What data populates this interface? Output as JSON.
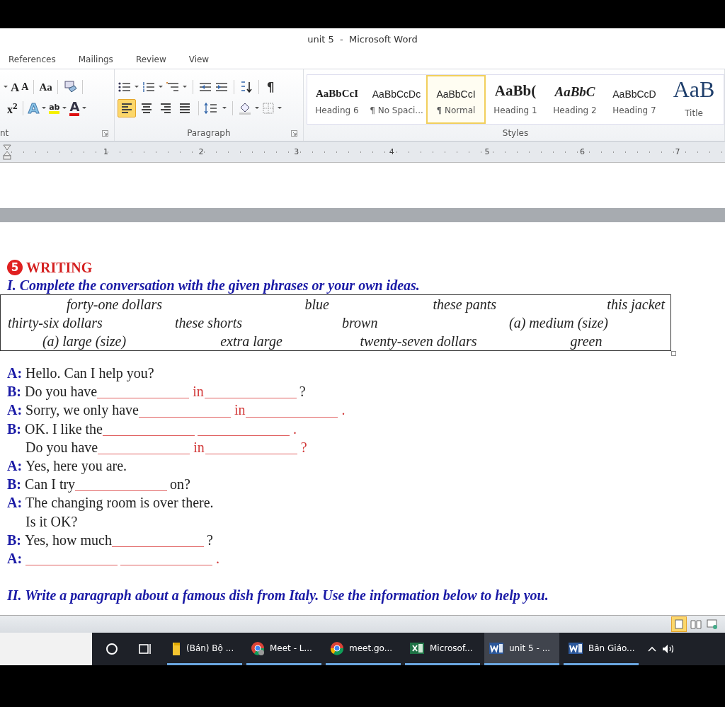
{
  "window": {
    "title": "unit 5  -  Microsoft Word"
  },
  "tabs": [
    {
      "label": "References",
      "selected": false
    },
    {
      "label": "Mailings",
      "selected": false
    },
    {
      "label": "Review",
      "selected": false
    },
    {
      "label": "View",
      "selected": false
    }
  ],
  "ribbon": {
    "font_group": {
      "label": "nt",
      "row1": [
        {
          "kind": "dropdown"
        },
        {
          "kind": "grow",
          "label": "A"
        },
        {
          "kind": "shrink",
          "label": "A"
        },
        {
          "kind": "case",
          "label": "Aa"
        },
        {
          "kind": "clear"
        }
      ],
      "row2": [
        {
          "kind": "superscript",
          "label": "x$^{2}$"
        },
        {
          "kind": "effects",
          "label": "A"
        },
        {
          "kind": "highlight",
          "label": "ab"
        },
        {
          "kind": "color",
          "label": "A"
        }
      ]
    },
    "paragraph_group": {
      "label": "Paragraph",
      "row1": [
        {
          "kind": "bullets"
        },
        {
          "kind": "numbering"
        },
        {
          "kind": "multilevel"
        },
        {
          "kind": "outdent"
        },
        {
          "kind": "indent"
        },
        {
          "kind": "sort"
        },
        {
          "kind": "pilcrow",
          "label": "¶"
        }
      ],
      "align": [
        {
          "selected": true
        },
        {
          "selected": false
        },
        {
          "selected": false
        },
        {
          "selected": false
        }
      ],
      "row2": [
        {
          "kind": "spacing"
        },
        {
          "kind": "shading"
        },
        {
          "kind": "borders"
        }
      ]
    },
    "styles_group": {
      "label": "Styles",
      "items": [
        {
          "sample": "AaBbCcI",
          "label": "Heading 6",
          "kind": "bold",
          "selected": false
        },
        {
          "sample": "AaBbCcDc",
          "label": "¶ No Spaci...",
          "kind": "plain",
          "selected": false
        },
        {
          "sample": "AaBbCcI",
          "label": "¶ Normal",
          "kind": "plain",
          "selected": true
        },
        {
          "sample": "AaBb(",
          "label": "Heading 1",
          "kind": "heavy",
          "selected": false
        },
        {
          "sample": "AaBbC",
          "label": "Heading 2",
          "kind": "italic",
          "selected": false
        },
        {
          "sample": "AaBbCcD",
          "label": "Heading 7",
          "kind": "plain",
          "selected": false
        },
        {
          "sample": "AaB",
          "label": "Title",
          "kind": "title",
          "selected": false
        }
      ]
    }
  },
  "ruler": {
    "numbers": [
      "1",
      "2",
      "3",
      "4",
      "5",
      "6",
      "7"
    ]
  },
  "document": {
    "section_number": "5",
    "section_title": "WRITING",
    "instruction_1": "I. Complete the conversation with the given phrases or your own ideas.",
    "word_box": [
      [
        "forty-one dollars",
        "blue",
        "these pants",
        "this jacket"
      ],
      [
        "thirty-six dollars",
        "these shorts",
        "brown",
        "(a) medium (size)"
      ],
      [
        "(a) large (size)",
        "extra large",
        "twenty-seven dollars",
        "green"
      ]
    ],
    "dialogue": [
      {
        "speaker": "A:",
        "parts": [
          {
            "kind": "text",
            "text": "Hello. Can I help you?"
          }
        ]
      },
      {
        "speaker": "B:",
        "parts": [
          {
            "kind": "text",
            "text": "Do you have"
          },
          {
            "kind": "blank"
          },
          {
            "kind": "red",
            "text": "in"
          },
          {
            "kind": "blank"
          },
          {
            "kind": "text",
            "text": "?"
          }
        ]
      },
      {
        "speaker": "A:",
        "parts": [
          {
            "kind": "text",
            "text": "Sorry, we only have"
          },
          {
            "kind": "blank"
          },
          {
            "kind": "red",
            "text": "in"
          },
          {
            "kind": "blank"
          },
          {
            "kind": "red",
            "text": "."
          }
        ]
      },
      {
        "speaker": "B:",
        "parts": [
          {
            "kind": "text",
            "text": "OK. I like the"
          },
          {
            "kind": "blank"
          },
          {
            "kind": "blank"
          },
          {
            "kind": "red",
            "text": "."
          }
        ]
      },
      {
        "parts": [
          {
            "kind": "text",
            "text": "Do you have"
          },
          {
            "kind": "blank"
          },
          {
            "kind": "red",
            "text": "in"
          },
          {
            "kind": "blank"
          },
          {
            "kind": "red",
            "text": "?"
          }
        ]
      },
      {
        "speaker": "A:",
        "parts": [
          {
            "kind": "text",
            "text": "Yes, here you are."
          }
        ]
      },
      {
        "speaker": "B:",
        "parts": [
          {
            "kind": "text",
            "text": "Can I try"
          },
          {
            "kind": "blank"
          },
          {
            "kind": "text",
            "text": "on?"
          }
        ]
      },
      {
        "speaker": "A:",
        "parts": [
          {
            "kind": "text",
            "text": "The changing room is over there."
          }
        ]
      },
      {
        "parts": [
          {
            "kind": "text",
            "text": "Is it OK?"
          }
        ]
      },
      {
        "speaker": "B:",
        "parts": [
          {
            "kind": "text",
            "text": "Yes, how much"
          },
          {
            "kind": "blank"
          },
          {
            "kind": "text",
            "text": "?"
          }
        ]
      },
      {
        "speaker": "A:",
        "parts": [
          {
            "kind": "blank"
          },
          {
            "kind": "blank"
          },
          {
            "kind": "red",
            "text": "."
          }
        ]
      }
    ],
    "instruction_2": "II. Write a paragraph about a famous dish from Italy. Use the information below to help you."
  },
  "status_bar": {
    "views": [
      {
        "selected": true
      },
      {
        "selected": false
      },
      {
        "selected": false
      }
    ]
  },
  "taskbar": {
    "apps": [
      {
        "kind": "folder",
        "label": "(Bán) Bộ ...",
        "selected": false
      },
      {
        "kind": "meet",
        "label": "Meet - L...",
        "selected": false
      },
      {
        "kind": "chrome",
        "label": "meet.go...",
        "selected": false
      },
      {
        "kind": "excel",
        "label": "Microsof...",
        "selected": false
      },
      {
        "kind": "word",
        "label": "unit 5 - ...",
        "selected": true
      },
      {
        "kind": "word",
        "label": "Bản Giáo...",
        "selected": false
      }
    ]
  }
}
